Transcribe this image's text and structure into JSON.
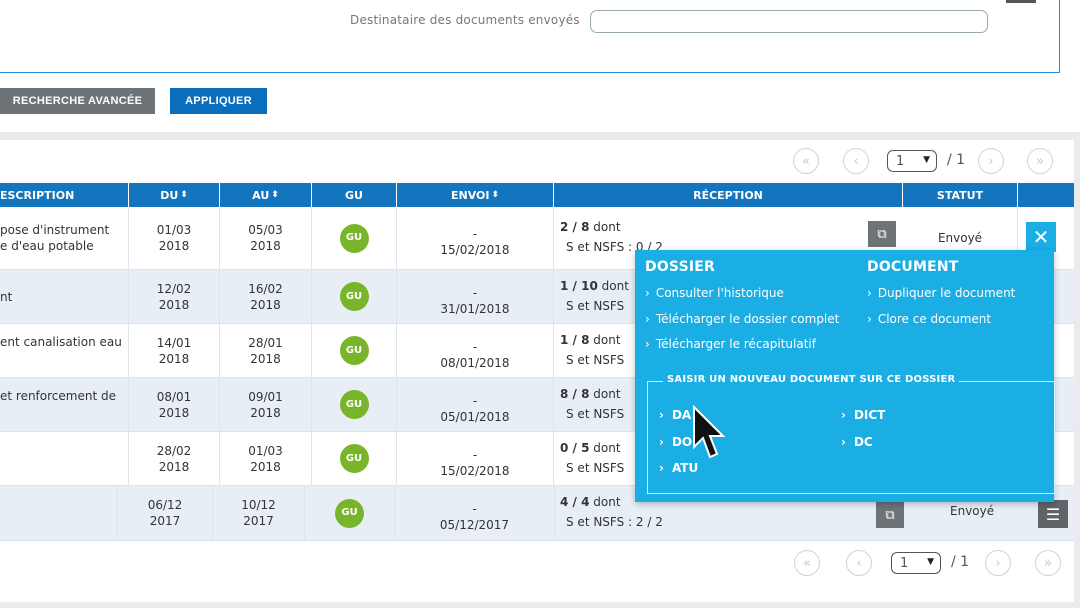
{
  "filters": {
    "recipient_label": "Destinataire des documents envoyés",
    "recipient_value": "",
    "advanced_search_label": "RECHERCHE AVANCÉE",
    "apply_label": "APPLIQUER"
  },
  "pagination": {
    "first": "«",
    "prev": "‹",
    "next": "›",
    "last": "»",
    "current_page": "1",
    "total": "/ 1"
  },
  "table": {
    "headers": {
      "description": "ESCRIPTION",
      "du": "DU",
      "au": "AU",
      "gu": "GU",
      "envoi": "ENVOI",
      "reception": "RÉCEPTION",
      "statut": "STATUT"
    },
    "sort_icon": "⬍",
    "rows": [
      {
        "desc_line1": "pose d'instrument",
        "desc_line2": "e d'eau potable",
        "du_date": "01/03",
        "du_year": "2018",
        "au_date": "05/03",
        "au_year": "2018",
        "gu": "GU",
        "envoi_dash": "-",
        "envoi_date": "15/02/2018",
        "recep_count": "2 / 8",
        "recep_dont": "dont",
        "recep_nsfs": "S et NSFS : 0 / 2",
        "statut": "Envoyé"
      },
      {
        "desc_line1": "nt",
        "desc_line2": "",
        "du_date": "12/02",
        "du_year": "2018",
        "au_date": "16/02",
        "au_year": "2018",
        "gu": "GU",
        "envoi_dash": "-",
        "envoi_date": "31/01/2018",
        "recep_count": "1 / 10",
        "recep_dont": "dont",
        "recep_nsfs": "S et NSFS",
        "statut": ""
      },
      {
        "desc_line1": "ent canalisation eau",
        "desc_line2": "",
        "du_date": "14/01",
        "du_year": "2018",
        "au_date": "28/01",
        "au_year": "2018",
        "gu": "GU",
        "envoi_dash": "-",
        "envoi_date": "08/01/2018",
        "recep_count": "1 / 8",
        "recep_dont": "dont",
        "recep_nsfs": "S et NSFS",
        "statut": ""
      },
      {
        "desc_line1": "et renforcement de",
        "desc_line2": "",
        "du_date": "08/01",
        "du_year": "2018",
        "au_date": "09/01",
        "au_year": "2018",
        "gu": "GU",
        "envoi_dash": "-",
        "envoi_date": "05/01/2018",
        "recep_count": "8 / 8",
        "recep_dont": "dont",
        "recep_nsfs": "S et NSFS",
        "statut": ""
      },
      {
        "desc_line1": "",
        "desc_line2": "",
        "du_date": "28/02",
        "du_year": "2018",
        "au_date": "01/03",
        "au_year": "2018",
        "gu": "GU",
        "envoi_dash": "-",
        "envoi_date": "15/02/2018",
        "recep_count": "0 / 5",
        "recep_dont": "dont",
        "recep_nsfs": "S et NSFS",
        "statut": ""
      },
      {
        "desc_line1": "",
        "desc_line2": "",
        "du_date": "06/12",
        "du_year": "2017",
        "au_date": "10/12",
        "au_year": "2017",
        "gu": "GU",
        "envoi_dash": "-",
        "envoi_date": "05/12/2017",
        "recep_count": "4 / 4",
        "recep_dont": "dont",
        "recep_nsfs": "S et NSFS : 2 / 2",
        "statut": "Envoyé"
      }
    ]
  },
  "popup": {
    "close": "✕",
    "dossier_title": "DOSSIER",
    "document_title": "DOCUMENT",
    "dossier_links": [
      "Consulter l'historique",
      "Télécharger le dossier complet",
      "Télécharger le récapitulatif"
    ],
    "document_links": [
      "Dupliquer le document",
      "Clore ce document"
    ],
    "new_doc_title": "SAISIR UN NOUVEAU DOCUMENT SUR CE DOSSIER",
    "new_doc_types": [
      "DA",
      "DO",
      "ATU",
      "DICT",
      "DC"
    ],
    "chevron": "›"
  },
  "icons": {
    "external_link": "external-link-icon",
    "menu": "hamburger-menu-icon",
    "close": "close-icon",
    "cursor": "mouse-cursor"
  },
  "colors": {
    "header_blue": "#1475bf",
    "apply_blue": "#0a6ebd",
    "popup_cyan": "#1aaee5",
    "gu_green": "#79b52b",
    "gray_button": "#6e7378"
  }
}
